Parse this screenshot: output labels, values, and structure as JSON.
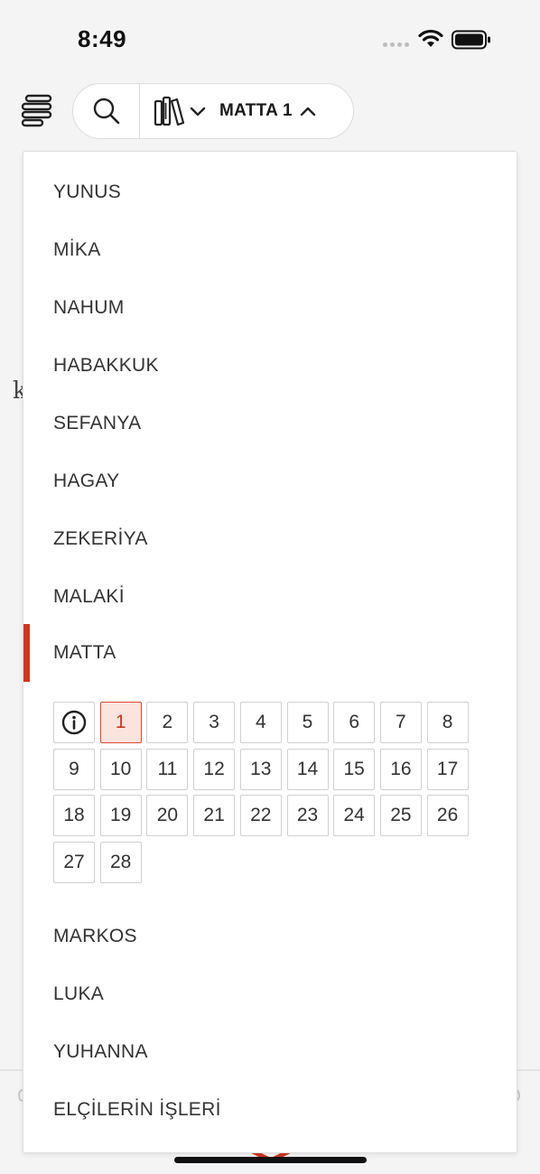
{
  "status_bar": {
    "time": "8:49"
  },
  "toolbar": {
    "current_book": "MATTA 1"
  },
  "background": {
    "letter": "k"
  },
  "books_before": [
    "YUNUS",
    "MİKA",
    "NAHUM",
    "HABAKKUK",
    "SEFANYA",
    "HAGAY",
    "ZEKERİYA",
    "MALAKİ"
  ],
  "selected_book": "MATTA",
  "chapters": [
    "1",
    "2",
    "3",
    "4",
    "5",
    "6",
    "7",
    "8",
    "9",
    "10",
    "11",
    "12",
    "13",
    "14",
    "15",
    "16",
    "17",
    "18",
    "19",
    "20",
    "21",
    "22",
    "23",
    "24",
    "25",
    "26",
    "27",
    "28"
  ],
  "selected_chapter": "1",
  "books_after": [
    "MARKOS",
    "LUKA",
    "YUHANNA",
    "ELÇİLERİN İŞLERİ"
  ],
  "colors": {
    "accent": "#d0361f",
    "selected_fill": "#fbe3de"
  },
  "icons": {
    "menu": "menu-lines-icon",
    "search": "search-icon",
    "library": "library-books-icon",
    "info": "info-icon"
  }
}
